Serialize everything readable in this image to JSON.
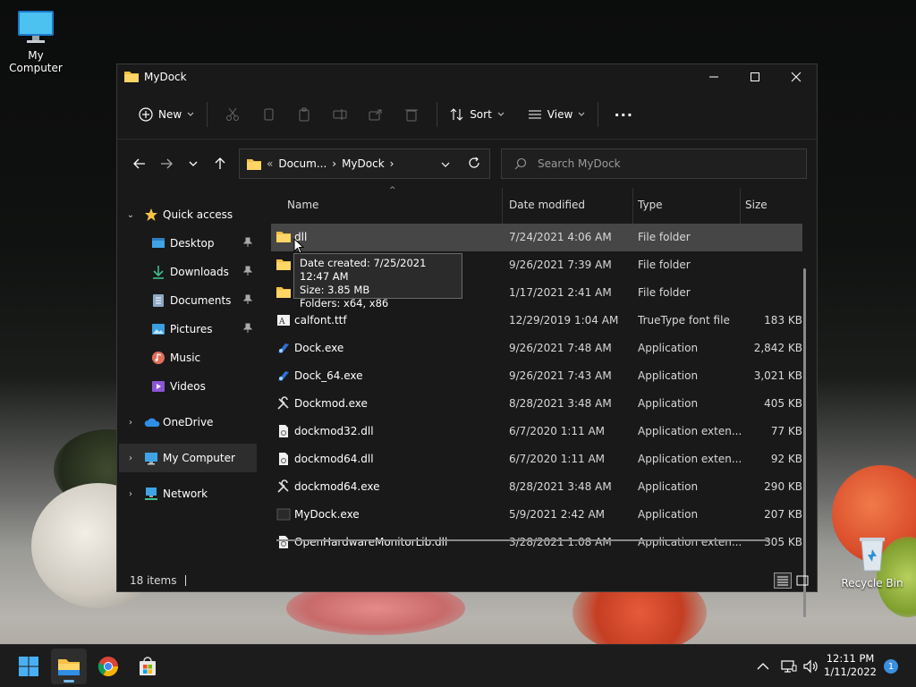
{
  "desktop": {
    "my_computer_label": "My Computer",
    "recycle_bin_label": "Recycle Bin"
  },
  "window": {
    "title": "MyDock",
    "controls": {
      "minimize": "minimize",
      "maximize": "maximize",
      "close": "close"
    }
  },
  "toolbar": {
    "new_label": "New",
    "sort_label": "Sort",
    "view_label": "View",
    "more_label": "..."
  },
  "address": {
    "crumb_sep": "«",
    "crumb_1": "Docum...",
    "crumb_2": "MyDock",
    "search_placeholder": "Search MyDock"
  },
  "nav": {
    "quick_access": "Quick access",
    "items": [
      "Desktop",
      "Downloads",
      "Documents",
      "Pictures",
      "Music",
      "Videos"
    ],
    "onedrive": "OneDrive",
    "my_computer": "My Computer",
    "network": "Network"
  },
  "columns": {
    "name": "Name",
    "date": "Date modified",
    "type": "Type",
    "size": "Size"
  },
  "files": [
    {
      "name": "dll",
      "date": "7/24/2021 4:06 AM",
      "type": "File folder",
      "size": "",
      "icon": "folder"
    },
    {
      "name": "",
      "date": "9/26/2021 7:39 AM",
      "type": "File folder",
      "size": "",
      "icon": "folder"
    },
    {
      "name": "",
      "date": "1/17/2021 2:41 AM",
      "type": "File folder",
      "size": "",
      "icon": "folder"
    },
    {
      "name": "calfont.ttf",
      "date": "12/29/2019 1:04 AM",
      "type": "TrueType font file",
      "size": "183 KB",
      "icon": "font"
    },
    {
      "name": "Dock.exe",
      "date": "9/26/2021 7:48 AM",
      "type": "Application",
      "size": "2,842 KB",
      "icon": "dock-exe"
    },
    {
      "name": "Dock_64.exe",
      "date": "9/26/2021 7:43 AM",
      "type": "Application",
      "size": "3,021 KB",
      "icon": "dock-exe"
    },
    {
      "name": "Dockmod.exe",
      "date": "8/28/2021 3:48 AM",
      "type": "Application",
      "size": "405 KB",
      "icon": "tools"
    },
    {
      "name": "dockmod32.dll",
      "date": "6/7/2020 1:11 AM",
      "type": "Application exten...",
      "size": "77 KB",
      "icon": "dll"
    },
    {
      "name": "dockmod64.dll",
      "date": "6/7/2020 1:11 AM",
      "type": "Application exten...",
      "size": "92 KB",
      "icon": "dll"
    },
    {
      "name": "dockmod64.exe",
      "date": "8/28/2021 3:48 AM",
      "type": "Application",
      "size": "290 KB",
      "icon": "tools"
    },
    {
      "name": "MyDock.exe",
      "date": "5/9/2021 2:42 AM",
      "type": "Application",
      "size": "207 KB",
      "icon": "app"
    },
    {
      "name": "OpenHardwareMonitorLib.dll",
      "date": "3/28/2021 1:08 AM",
      "type": "Application exten...",
      "size": "305 KB",
      "icon": "dll"
    }
  ],
  "tooltip": {
    "line1": "Date created: 7/25/2021 12:47 AM",
    "line2": "Size: 3.85 MB",
    "line3": "Folders: x64, x86"
  },
  "status": {
    "items_count": "18 items"
  },
  "taskbar": {
    "time": "12:11 PM",
    "date": "1/11/2022",
    "notification_count": "1"
  }
}
